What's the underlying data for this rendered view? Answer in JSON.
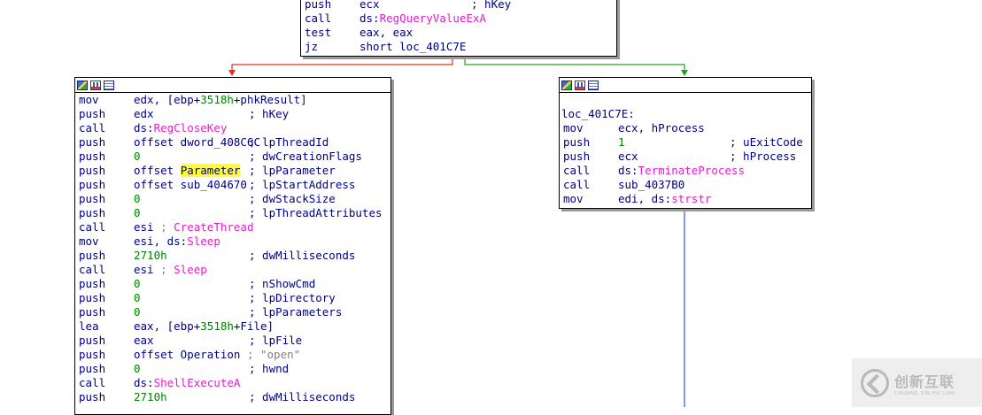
{
  "colors": {
    "background": "#ffffff",
    "text": "#000080",
    "api": "#e020c8",
    "number": "#008000",
    "string": "#808080",
    "highlight": "#ffff33",
    "edge_false": "#e03020",
    "edge_true": "#20a020",
    "edge_flow": "#3050d0"
  },
  "top_block": {
    "lines": [
      {
        "mnemonic": "push",
        "parts": [
          {
            "t": "ecx",
            "c": "reg"
          }
        ],
        "comment": "; hKey"
      },
      {
        "mnemonic": "call",
        "parts": [
          {
            "t": "ds:",
            "c": "reg"
          },
          {
            "t": "RegQueryValueExA",
            "c": "api"
          }
        ],
        "comment": ""
      },
      {
        "mnemonic": "test",
        "parts": [
          {
            "t": "eax, eax",
            "c": "reg"
          }
        ],
        "comment": ""
      },
      {
        "mnemonic": "jz",
        "parts": [
          {
            "t": "short loc_401C7E",
            "c": "reg"
          }
        ],
        "comment": ""
      }
    ]
  },
  "left_block": {
    "lines": [
      {
        "mnemonic": "mov",
        "parts": [
          {
            "t": "edx, [ebp+",
            "c": "reg"
          },
          {
            "t": "3518h",
            "c": "num"
          },
          {
            "t": "+phkResult]",
            "c": "reg"
          }
        ],
        "comment": ""
      },
      {
        "mnemonic": "push",
        "parts": [
          {
            "t": "edx",
            "c": "reg"
          }
        ],
        "comment": "; hKey"
      },
      {
        "mnemonic": "call",
        "parts": [
          {
            "t": "ds:",
            "c": "reg"
          },
          {
            "t": "RegCloseKey",
            "c": "api"
          }
        ],
        "comment": ""
      },
      {
        "mnemonic": "push",
        "parts": [
          {
            "t": "offset dword_408C6C",
            "c": "reg"
          }
        ],
        "comment": "; lpThreadId"
      },
      {
        "mnemonic": "push",
        "parts": [
          {
            "t": "0",
            "c": "num"
          }
        ],
        "comment": "; dwCreationFlags"
      },
      {
        "mnemonic": "push",
        "parts": [
          {
            "t": "offset ",
            "c": "reg"
          },
          {
            "t": "Parameter",
            "c": "hl"
          }
        ],
        "comment": "; lpParameter"
      },
      {
        "mnemonic": "push",
        "parts": [
          {
            "t": "offset sub_404670",
            "c": "reg"
          }
        ],
        "comment": "; lpStartAddress"
      },
      {
        "mnemonic": "push",
        "parts": [
          {
            "t": "0",
            "c": "num"
          }
        ],
        "comment": "; dwStackSize"
      },
      {
        "mnemonic": "push",
        "parts": [
          {
            "t": "0",
            "c": "num"
          }
        ],
        "comment": "; lpThreadAttributes"
      },
      {
        "mnemonic": "call",
        "parts": [
          {
            "t": "esi ",
            "c": "reg"
          },
          {
            "t": "; ",
            "c": "sep"
          },
          {
            "t": "CreateThread",
            "c": "api"
          }
        ],
        "comment": ""
      },
      {
        "mnemonic": "mov",
        "parts": [
          {
            "t": "esi, ds:",
            "c": "reg"
          },
          {
            "t": "Sleep",
            "c": "api"
          }
        ],
        "comment": ""
      },
      {
        "mnemonic": "push",
        "parts": [
          {
            "t": "2710h",
            "c": "num"
          }
        ],
        "comment": "; dwMilliseconds"
      },
      {
        "mnemonic": "call",
        "parts": [
          {
            "t": "esi ",
            "c": "reg"
          },
          {
            "t": "; ",
            "c": "sep"
          },
          {
            "t": "Sleep",
            "c": "api"
          }
        ],
        "comment": ""
      },
      {
        "mnemonic": "push",
        "parts": [
          {
            "t": "0",
            "c": "num"
          }
        ],
        "comment": "; nShowCmd"
      },
      {
        "mnemonic": "push",
        "parts": [
          {
            "t": "0",
            "c": "num"
          }
        ],
        "comment": "; lpDirectory"
      },
      {
        "mnemonic": "push",
        "parts": [
          {
            "t": "0",
            "c": "num"
          }
        ],
        "comment": "; lpParameters"
      },
      {
        "mnemonic": "lea",
        "parts": [
          {
            "t": "eax, [ebp+",
            "c": "reg"
          },
          {
            "t": "3518h",
            "c": "num"
          },
          {
            "t": "+File]",
            "c": "reg"
          }
        ],
        "comment": ""
      },
      {
        "mnemonic": "push",
        "parts": [
          {
            "t": "eax",
            "c": "reg"
          }
        ],
        "comment": "; lpFile"
      },
      {
        "mnemonic": "push",
        "parts": [
          {
            "t": "offset Operation ",
            "c": "reg"
          },
          {
            "t": "; \"open\"",
            "c": "str"
          }
        ],
        "comment": ""
      },
      {
        "mnemonic": "push",
        "parts": [
          {
            "t": "0",
            "c": "num"
          }
        ],
        "comment": "; hwnd"
      },
      {
        "mnemonic": "call",
        "parts": [
          {
            "t": "ds:",
            "c": "reg"
          },
          {
            "t": "ShellExecuteA",
            "c": "api"
          }
        ],
        "comment": ""
      },
      {
        "mnemonic": "push",
        "parts": [
          {
            "t": "2710h",
            "c": "num"
          }
        ],
        "comment": "; dwMilliseconds"
      }
    ]
  },
  "right_block": {
    "label": "loc_401C7E:",
    "lines": [
      {
        "mnemonic": "mov",
        "parts": [
          {
            "t": "ecx, hProcess",
            "c": "reg"
          }
        ],
        "comment": ""
      },
      {
        "mnemonic": "push",
        "parts": [
          {
            "t": "1",
            "c": "num"
          }
        ],
        "comment": "; uExitCode"
      },
      {
        "mnemonic": "push",
        "parts": [
          {
            "t": "ecx",
            "c": "reg"
          }
        ],
        "comment": "; hProcess"
      },
      {
        "mnemonic": "call",
        "parts": [
          {
            "t": "ds:",
            "c": "reg"
          },
          {
            "t": "TerminateProcess",
            "c": "api"
          }
        ],
        "comment": ""
      },
      {
        "mnemonic": "call",
        "parts": [
          {
            "t": "sub_4037B0",
            "c": "reg"
          }
        ],
        "comment": ""
      },
      {
        "mnemonic": "mov",
        "parts": [
          {
            "t": "edi, ds:",
            "c": "reg"
          },
          {
            "t": "strstr",
            "c": "api"
          }
        ],
        "comment": ""
      }
    ]
  },
  "watermark": {
    "cn": "创新互联",
    "en": "CHUANG XIN HU LIAN"
  }
}
